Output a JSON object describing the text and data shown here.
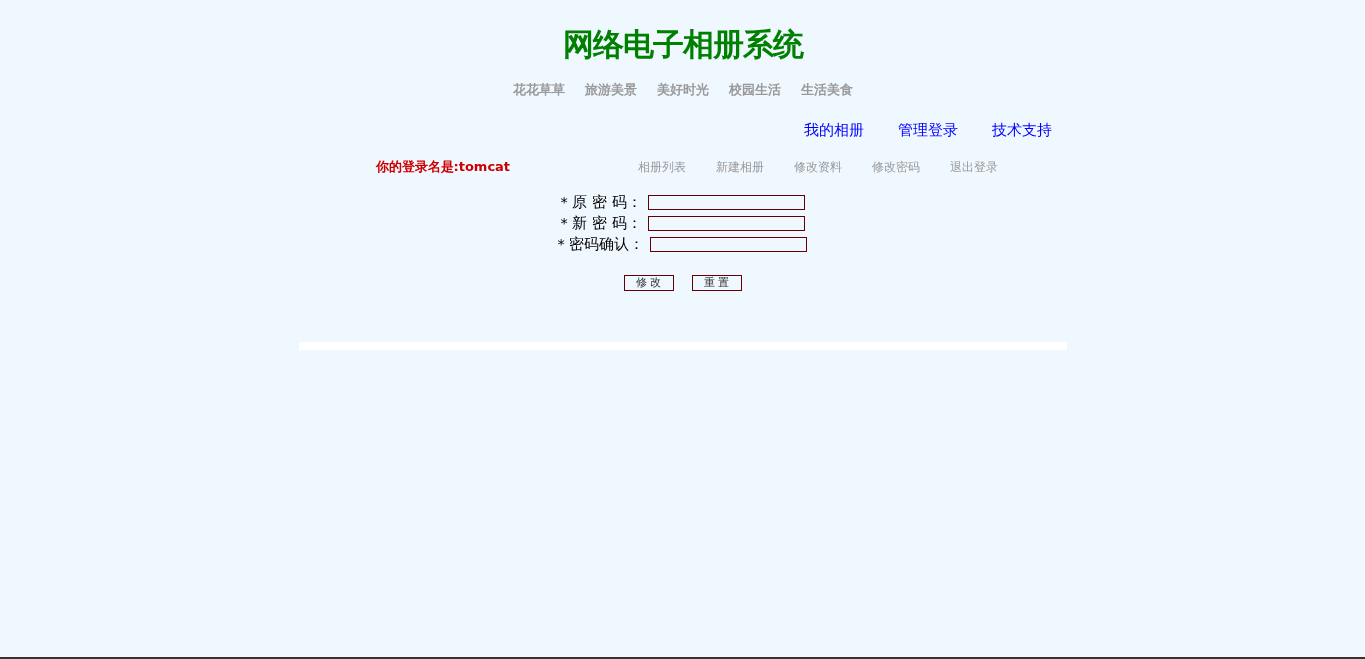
{
  "site_title": "网络电子相册系统",
  "categories": [
    "花花草草",
    "旅游美景",
    "美好时光",
    "校园生活",
    "生活美食"
  ],
  "top_links": [
    "我的相册",
    "管理登录",
    "技术支持"
  ],
  "user_greeting": "你的登录名是:tomcat",
  "user_menu": [
    "相册列表",
    "新建相册",
    "修改资料",
    "修改密码",
    "退出登录"
  ],
  "form": {
    "fields": [
      {
        "label": "* 原 密 码："
      },
      {
        "label": "* 新 密 码："
      },
      {
        "label": "* 密码确认："
      }
    ],
    "buttons": [
      "修 改",
      "重 置"
    ]
  }
}
